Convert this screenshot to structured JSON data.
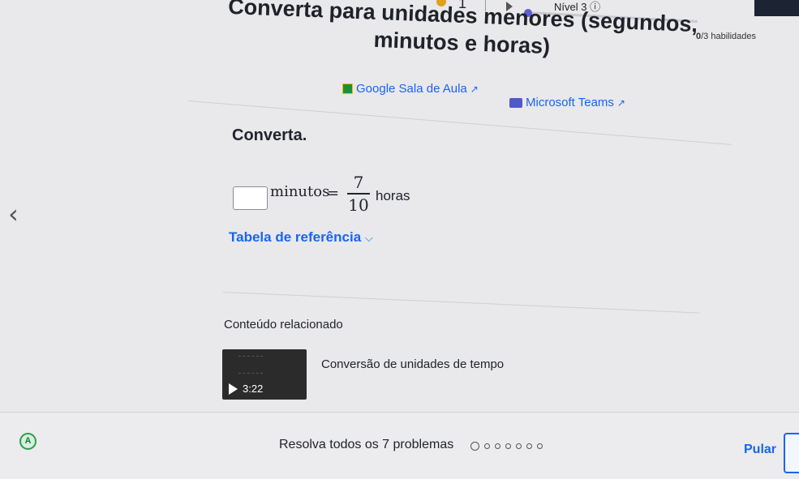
{
  "topbar": {
    "level_label": "Nível 3 ⓘ",
    "counter": "1",
    "skills_count": "0",
    "skills_label": "/3 habilidades"
  },
  "title": "Converta para unidades menores (segundos, minutos e horas)",
  "share": {
    "google_classroom": "Google Sala de Aula",
    "microsoft_teams": "Microsoft Teams"
  },
  "problem": {
    "prompt": "Converta.",
    "answer_value": "",
    "unit_left": "minutos",
    "equals": "=",
    "fraction_numerator": "7",
    "fraction_denominator": "10",
    "unit_right": "horas"
  },
  "reference_table": {
    "label": "Tabela de referência",
    "chevron": "⌵"
  },
  "related": {
    "heading": "Conteúdo relacionado",
    "video_title": "Conversão de unidades de tempo",
    "video_duration": "3:22"
  },
  "footer": {
    "solve_text": "Resolva todos os 7 problemas",
    "skip_label": "Pular",
    "avatar_letter": "A"
  },
  "colors": {
    "accent": "#1865f2",
    "progress": "#5b5fd6"
  }
}
